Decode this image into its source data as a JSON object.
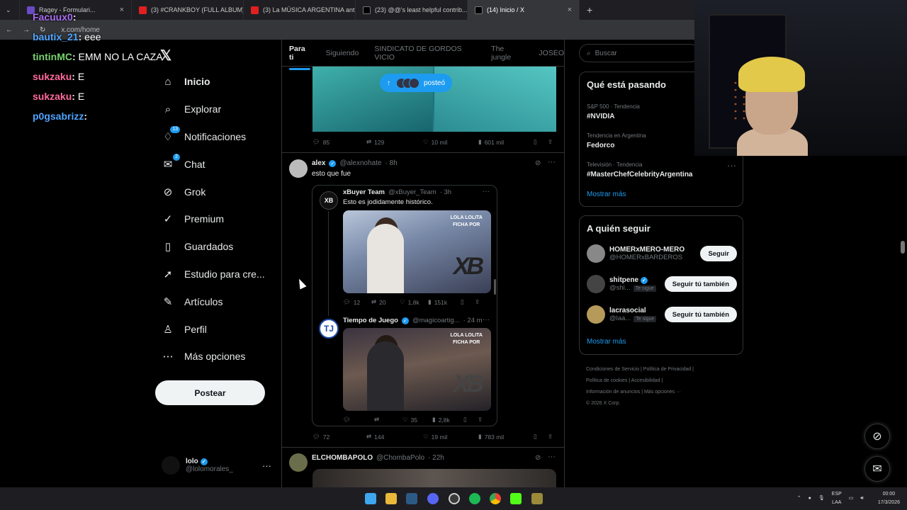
{
  "browser": {
    "tabs": [
      {
        "label": "Ragey - Formulari...",
        "color": "#6a4bc4",
        "active": false
      },
      {
        "label": "(3) #CRANKBOY (FULL ALBUM) ...",
        "color": "#e02020",
        "active": false
      },
      {
        "label": "(3) La MÚSICA ARGENTINA anti...",
        "color": "#e02020",
        "active": false
      },
      {
        "label": "(23) @@'s least helpful contrib...",
        "color": "#000000",
        "active": false
      },
      {
        "label": "(14) Inicio / X",
        "color": "#000000",
        "active": true
      }
    ],
    "url": "x.com/home",
    "new_tab": "+"
  },
  "stream_chat": [
    {
      "user": "Facuux0",
      "color": "#a86cf0",
      "text": ""
    },
    {
      "user": "bautix_21",
      "color": "#4fa3ff",
      "text": "eee"
    },
    {
      "user": "tintinMC",
      "color": "#78d26f",
      "text": "EMM NO LA CAZA"
    },
    {
      "user": "sukzaku",
      "color": "#ff6a9e",
      "text": "E"
    },
    {
      "user": "sukzaku",
      "color": "#ff6a9e",
      "text": "E"
    },
    {
      "user": "p0gsabrizz",
      "color": "#4fa3ff",
      "text": ""
    }
  ],
  "nav": [
    {
      "label": "Inicio",
      "icon": "home-icon",
      "glyph": "⌂",
      "badge": ""
    },
    {
      "label": "Explorar",
      "icon": "search-icon",
      "glyph": "⌕",
      "badge": ""
    },
    {
      "label": "Notificaciones",
      "icon": "bell-icon",
      "glyph": "♢",
      "badge": "13"
    },
    {
      "label": "Chat",
      "icon": "mail-icon",
      "glyph": "✉",
      "badge": "2"
    },
    {
      "label": "Grok",
      "icon": "grok-icon",
      "glyph": "⊘",
      "badge": ""
    },
    {
      "label": "Premium",
      "icon": "premium-icon",
      "glyph": "✓",
      "badge": ""
    },
    {
      "label": "Guardados",
      "icon": "bookmark-icon",
      "glyph": "▯",
      "badge": ""
    },
    {
      "label": "Estudio para cre...",
      "icon": "rocket-icon",
      "glyph": "➚",
      "badge": ""
    },
    {
      "label": "Artículos",
      "icon": "article-icon",
      "glyph": "✎",
      "badge": ""
    },
    {
      "label": "Perfil",
      "icon": "person-icon",
      "glyph": "♙",
      "badge": ""
    },
    {
      "label": "Más opciones",
      "icon": "more-circle-icon",
      "glyph": "⋯",
      "badge": ""
    }
  ],
  "post_button": "Postear",
  "me": {
    "name": "lolo",
    "handle": "@lolomorales_",
    "more": "···"
  },
  "timeline_tabs": [
    "Para ti",
    "Siguiendo",
    "SINDICATO DE GORDOS VICIO",
    "The jungle",
    "JOSEO"
  ],
  "posted_pill": "posteó",
  "post1": {
    "replies": "85",
    "reposts": "129",
    "likes": "10 mil",
    "views": "601 mil"
  },
  "post2": {
    "name": "alex",
    "handle": "@alexnohate",
    "time": "· 8h",
    "text": "esto que fue",
    "replies": "72",
    "reposts": "144",
    "likes": "19 mil",
    "views": "783 mil"
  },
  "quote1": {
    "name": "xBuyer Team",
    "handle": "@xBuyer_Team",
    "time": "· 3h",
    "text": "Esto es jodidamente histórico.",
    "image_caption_1": "LOLA LOLITA",
    "image_caption_2": "FICHA POR",
    "image_logo": "XB",
    "replies": "12",
    "reposts": "20",
    "likes": "1,8k",
    "views": "151k"
  },
  "quote2": {
    "name": "Tiempo de Juego",
    "handle": "@magicoartig...",
    "time": "· 24 m",
    "image_caption_1": "LOLA LOLITA",
    "image_caption_2": "FICHA POR",
    "image_logo": "XB",
    "replies": "",
    "reposts": "",
    "likes": "35",
    "views": "2,8k"
  },
  "post3": {
    "name": "ELCHOMBAPOLO",
    "handle": "@ChombaPolo",
    "time": "· 22h"
  },
  "search": {
    "placeholder": "Buscar"
  },
  "trends": {
    "title": "Qué está pasando",
    "items": [
      {
        "context": "S&P 500 · Tendencia",
        "name": "#NVIDIA"
      },
      {
        "context": "Tendencia en Argentina",
        "name": "Fedorco"
      },
      {
        "context": "Televisión · Tendencia",
        "name": "#MasterChefCelebrityArgentina"
      }
    ],
    "more": "Mostrar más"
  },
  "who_to_follow": {
    "title": "A quién seguir",
    "items": [
      {
        "name": "HOMERxMERO-MERO",
        "handle": "@HOMERxBARDEROS",
        "verified": false,
        "follows_you": "",
        "button": "Seguir"
      },
      {
        "name": "shitpene",
        "handle": "@shi...",
        "verified": true,
        "follows_you": "Te sigue",
        "button": "Seguir tú también"
      },
      {
        "name": "lacrasocial",
        "handle": "@laa...",
        "verified": false,
        "follows_you": "Te sigue",
        "button": "Seguir tú también"
      }
    ],
    "more": "Mostrar más"
  },
  "footer": {
    "line1": "Condiciones de Servicio  |  Política de Privacidad  |",
    "line2": "Política de cookies  |  Accesibilidad  |",
    "line3": "Información de anuncios  |  Más opciones ···",
    "line4": "© 2026 X Corp."
  },
  "taskbar": {
    "lang1": "ESP",
    "lang2": "LAA",
    "time": "00:00",
    "date": "17/3/2026"
  },
  "colors": {
    "accent": "#1d9bf0",
    "bg": "#000000",
    "border": "#2f3336",
    "muted": "#71767b"
  }
}
